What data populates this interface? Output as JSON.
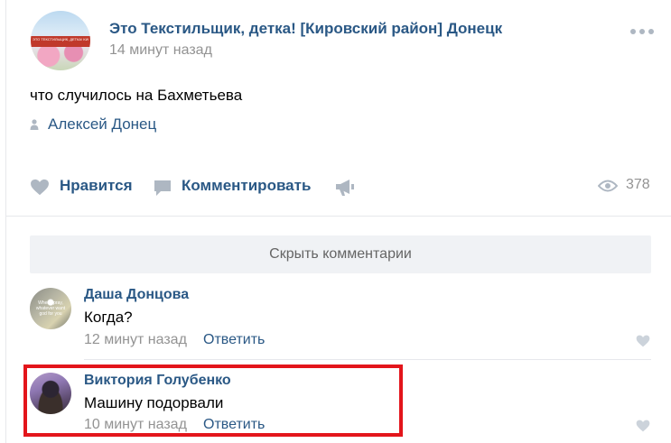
{
  "post": {
    "group_name": "Это Текстильщик, детка! [Кировский район] Донецк",
    "time": "14 минут назад",
    "text": "что случилось на Бахметьева",
    "author": "Алексей Донец",
    "avatar_banner": "ЭТО ТЕКСТИЛЬЩИК, ДЕТКА! КИРОВСКИЙ РАЙОН"
  },
  "actions": {
    "like_label": "Нравится",
    "comment_label": "Комментировать",
    "views_count": "378"
  },
  "hide_comments_label": "Скрыть комментарии",
  "comments": [
    {
      "author": "Даша Донцова",
      "text": "Когда?",
      "time": "12 минут назад",
      "reply_label": "Ответить",
      "avatar_text": "When i pray, whatever want god for you"
    },
    {
      "author": "Виктория Голубенко",
      "text": "Машину подорвали",
      "time": "10 минут назад",
      "reply_label": "Ответить"
    }
  ],
  "icons": {
    "more": "more-dots-icon",
    "author": "person-icon",
    "like": "heart-icon",
    "comment": "comment-bubble-icon",
    "share": "megaphone-icon",
    "views": "eye-icon"
  },
  "colors": {
    "link": "#2a5885",
    "muted": "#939393",
    "icon": "#aeb7c2",
    "highlight": "#e3151b"
  }
}
